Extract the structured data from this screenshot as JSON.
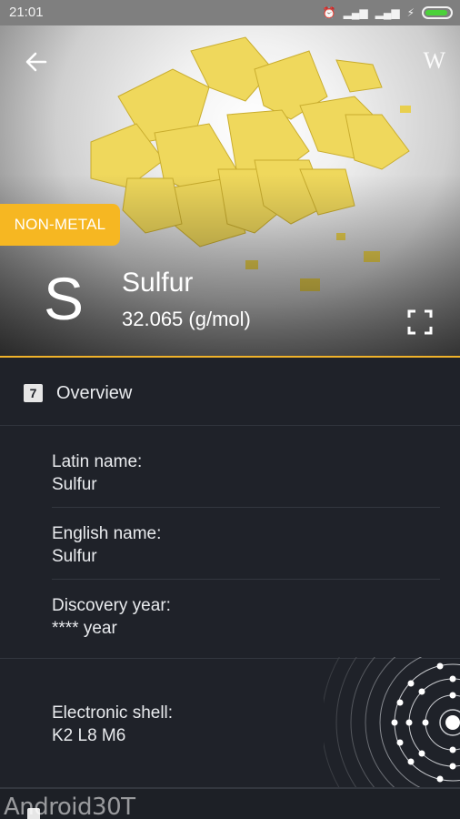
{
  "status_bar": {
    "time": "21:01",
    "icons": [
      "alarm-icon",
      "signal-icon",
      "signal-icon",
      "charging-icon",
      "battery-icon"
    ],
    "battery_color": "#4bd13a"
  },
  "hero": {
    "category": "NON-METAL",
    "category_color": "#f6b722",
    "symbol": "S",
    "name": "Sulfur",
    "mass": "32.065 (g/mol)",
    "wiki_label": "W",
    "accent_color": "#f0b22a"
  },
  "overview": {
    "number": "7",
    "title": "Overview",
    "latin_label": "Latin name:",
    "latin_value": "Sulfur",
    "english_label": "English name:",
    "english_value": "Sulfur",
    "discovery_label": "Discovery year:",
    "discovery_value": "**** year",
    "shell_label": "Electronic shell:",
    "shell_value": "K2 L8 M6"
  },
  "watermark": "Android30T"
}
